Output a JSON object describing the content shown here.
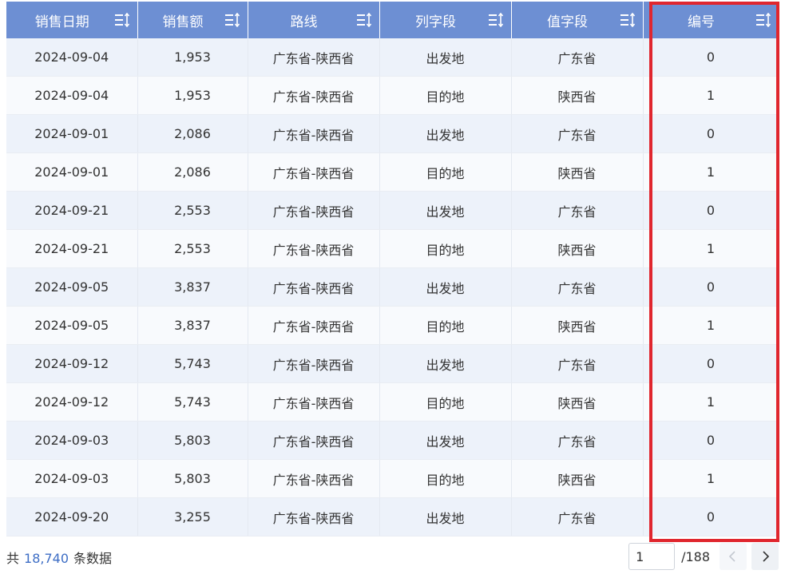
{
  "columns": [
    "销售日期",
    "销售额",
    "路线",
    "列字段",
    "值字段",
    "编号"
  ],
  "rows": [
    [
      "2024-09-04",
      "1,953",
      "广东省-陕西省",
      "出发地",
      "广东省",
      "0"
    ],
    [
      "2024-09-04",
      "1,953",
      "广东省-陕西省",
      "目的地",
      "陕西省",
      "1"
    ],
    [
      "2024-09-01",
      "2,086",
      "广东省-陕西省",
      "出发地",
      "广东省",
      "0"
    ],
    [
      "2024-09-01",
      "2,086",
      "广东省-陕西省",
      "目的地",
      "陕西省",
      "1"
    ],
    [
      "2024-09-21",
      "2,553",
      "广东省-陕西省",
      "出发地",
      "广东省",
      "0"
    ],
    [
      "2024-09-21",
      "2,553",
      "广东省-陕西省",
      "目的地",
      "陕西省",
      "1"
    ],
    [
      "2024-09-05",
      "3,837",
      "广东省-陕西省",
      "出发地",
      "广东省",
      "0"
    ],
    [
      "2024-09-05",
      "3,837",
      "广东省-陕西省",
      "目的地",
      "陕西省",
      "1"
    ],
    [
      "2024-09-12",
      "5,743",
      "广东省-陕西省",
      "出发地",
      "广东省",
      "0"
    ],
    [
      "2024-09-12",
      "5,743",
      "广东省-陕西省",
      "目的地",
      "陕西省",
      "1"
    ],
    [
      "2024-09-03",
      "5,803",
      "广东省-陕西省",
      "出发地",
      "广东省",
      "0"
    ],
    [
      "2024-09-03",
      "5,803",
      "广东省-陕西省",
      "目的地",
      "陕西省",
      "1"
    ],
    [
      "2024-09-20",
      "3,255",
      "广东省-陕西省",
      "出发地",
      "广东省",
      "0"
    ]
  ],
  "footer": {
    "total_prefix": "共",
    "total_count": "18,740",
    "total_suffix": "条数据",
    "page_value": "1",
    "page_total": "/188"
  },
  "colors": {
    "header_bg": "#6d8fd3",
    "row_even": "#f8fafd",
    "row_odd": "#edf2fa",
    "highlight_border": "#e0262e",
    "count_text": "#3e6ec5"
  },
  "icons": {
    "sort": "sort-icon",
    "prev": "chevron-left-icon",
    "next": "chevron-right-icon"
  }
}
